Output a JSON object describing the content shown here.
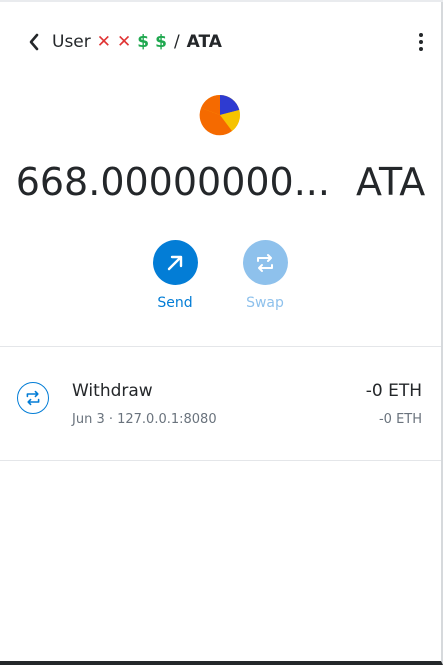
{
  "header": {
    "account_name": "User",
    "account_emoji": [
      "✕",
      "✕",
      "$",
      "$"
    ],
    "separator": "/",
    "token_symbol": "ATA"
  },
  "balance": {
    "amount": "668.00000000...",
    "symbol": "ATA"
  },
  "actions": {
    "send_label": "Send",
    "swap_label": "Swap"
  },
  "transaction": {
    "title": "Withdraw",
    "date": "Jun 3",
    "origin": "127.0.0.1:8080",
    "subtitle": "Jun 3 · 127.0.0.1:8080",
    "amount_primary": "-0 ETH",
    "amount_secondary": "-0 ETH"
  },
  "colors": {
    "primary": "#037dd6",
    "primary_disabled": "#8ec1ec",
    "text": "#24272a",
    "muted": "#6a737d",
    "token_orange": "#f56a00",
    "token_blue": "#2e3bd1",
    "token_yellow": "#f6c300"
  },
  "icons": {
    "back": "chevron-left-icon",
    "menu": "kebab-menu-icon",
    "send": "arrow-up-right-icon",
    "swap": "swap-arrows-icon",
    "token": "ata-token-icon"
  }
}
